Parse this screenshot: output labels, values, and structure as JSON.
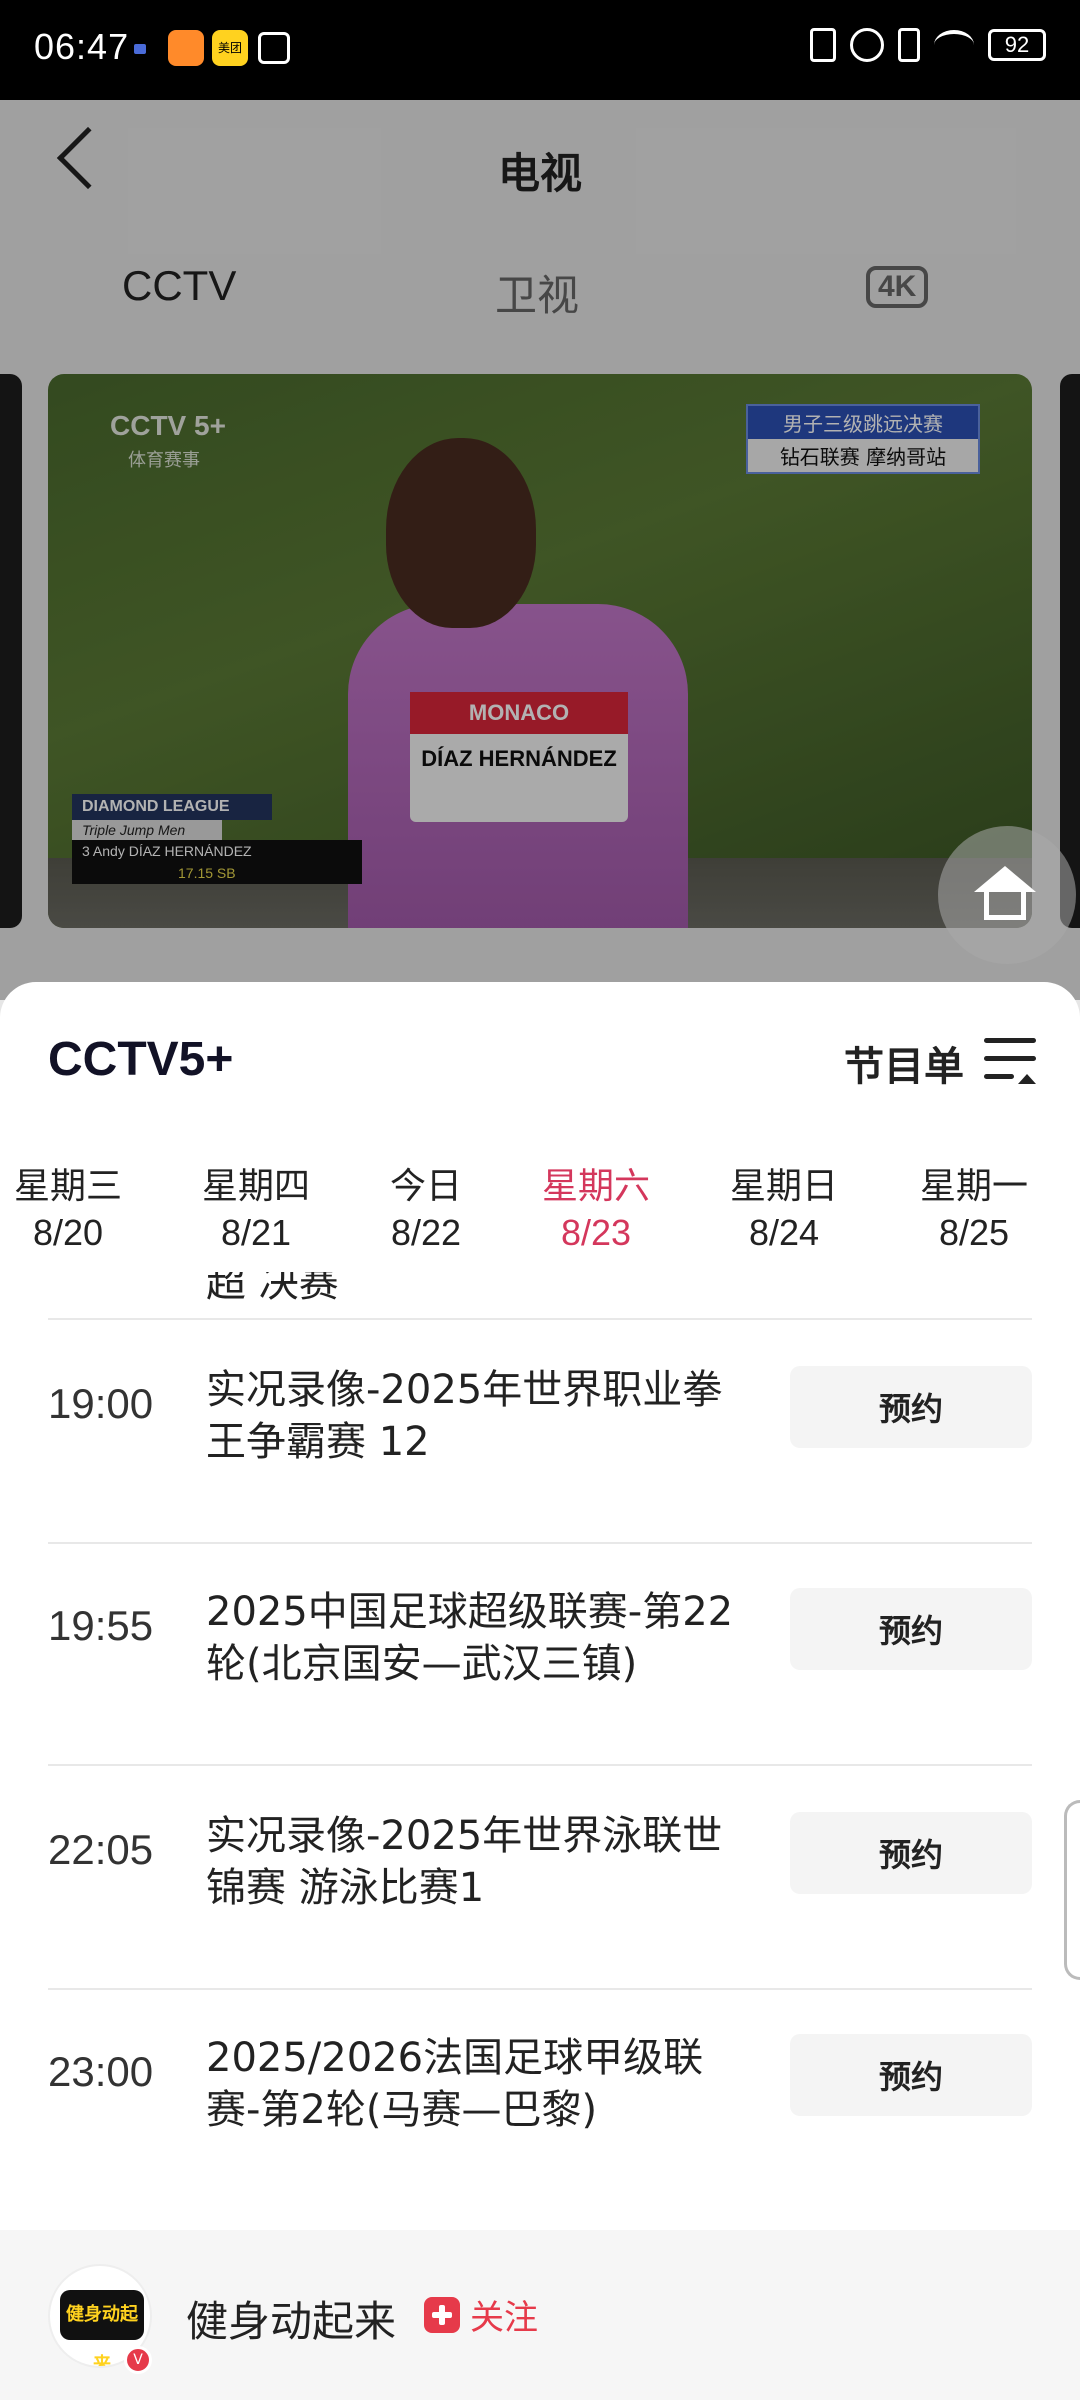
{
  "status_bar": {
    "time": "06:47",
    "app_icon_meituan": "美团",
    "battery": "92"
  },
  "header": {
    "title": "电视",
    "tabs": [
      {
        "label": "CCTV"
      },
      {
        "label": "卫视"
      },
      {
        "label": "4K"
      }
    ]
  },
  "video": {
    "channel_logo": "CCTV 5+",
    "channel_logo_sub": "体育赛事",
    "caption_line1": "男子三级跳远决赛",
    "caption_line2": "钻石联赛 摩纳哥站",
    "bib_top": "MONACO",
    "bib_name": "DÍAZ HERNÁNDEZ",
    "score_title": "DIAMOND LEAGUE",
    "score_event": "Triple Jump Men",
    "score_athlete": "3  Andy DÍAZ HERNÁNDEZ",
    "score_result": "17.15  SB"
  },
  "sheet": {
    "channel_name": "CCTV5+",
    "schedule_label": "节目单",
    "days": [
      {
        "weekday": "星期三",
        "date": "8/20",
        "active": false
      },
      {
        "weekday": "星期四",
        "date": "8/21",
        "active": false
      },
      {
        "weekday": "今日",
        "date": "8/22",
        "active": false
      },
      {
        "weekday": "星期六",
        "date": "8/23",
        "active": true
      },
      {
        "weekday": "星期日",
        "date": "8/24",
        "active": false
      },
      {
        "weekday": "星期一",
        "date": "8/25",
        "active": false
      }
    ],
    "cut_text": "超 决赛",
    "programs": [
      {
        "time": "19:00",
        "title": "实况录像-2025年世界职业拳王争霸赛 12",
        "button": "预约"
      },
      {
        "time": "19:55",
        "title": "2025中国足球超级联赛-第22轮(北京国安—武汉三镇)",
        "button": "预约"
      },
      {
        "time": "22:05",
        "title": "实况录像-2025年世界泳联世锦赛 游泳比赛1",
        "button": "预约"
      },
      {
        "time": "23:00",
        "title": "2025/2026法国足球甲级联赛-第2轮(马赛—巴黎)",
        "button": "预约"
      }
    ]
  },
  "footer": {
    "avatar_text": "健身动起来",
    "account_name": "健身动起来",
    "follow_label": "关注"
  },
  "colors": {
    "accent_red": "#d4375c",
    "follow_red": "#e63a4a"
  },
  "icons": [
    "back-icon",
    "home-icon",
    "menu-icon",
    "plus-icon"
  ]
}
